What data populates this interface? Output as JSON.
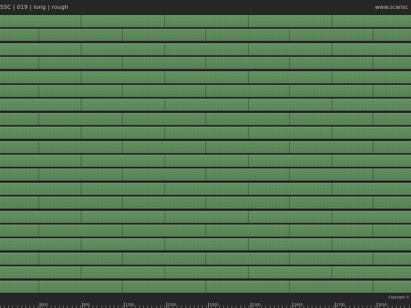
{
  "header": {
    "title": "SSC | 019 | long | rough",
    "site": "www.scansc"
  },
  "footer": {
    "copyright": "Copyright ©",
    "ruler_labels": [
      "600",
      "900",
      "1200",
      "1500",
      "1800",
      "2100",
      "2400",
      "2700",
      "3000"
    ]
  },
  "colors": {
    "tile": "#5c8b5a",
    "joint": "#223322",
    "bars": "#262626"
  }
}
